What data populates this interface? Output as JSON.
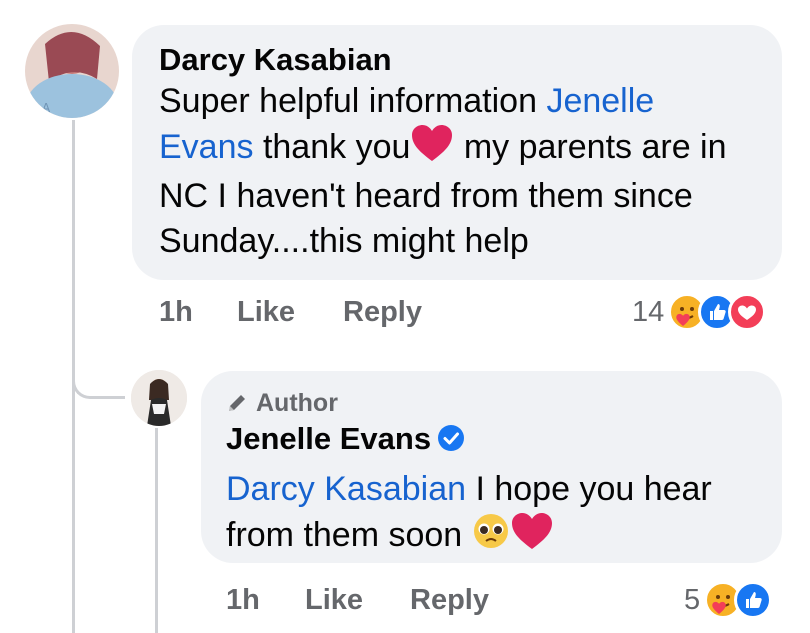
{
  "comment": {
    "author": "Darcy Kasabian",
    "text_lines": [
      {
        "pre": "Super helpful information ",
        "mention": "Jenelle",
        "post": ""
      },
      {
        "pre": "",
        "mention": "Evans",
        "post": " thank you"
      },
      {
        "pre": "",
        "mention": "",
        "post": " my parents are in"
      },
      {
        "pre": "NC I haven't heard from them since",
        "mention": "",
        "post": ""
      },
      {
        "pre": "Sunday....this might help",
        "mention": "",
        "post": ""
      }
    ],
    "time": "1h",
    "like_label": "Like",
    "reply_label": "Reply",
    "reaction_count": "14",
    "reactions": [
      "care-icon",
      "like-icon",
      "love-icon"
    ]
  },
  "reply": {
    "badge": "Author",
    "author": "Jenelle Evans",
    "verified": true,
    "mention": "Darcy Kasabian",
    "text_line1": " I hope you hear",
    "text_line2": "from them soon ",
    "time": "1h",
    "like_label": "Like",
    "reply_label": "Reply",
    "reaction_count": "5",
    "reactions": [
      "care-icon",
      "like-icon"
    ]
  },
  "colors": {
    "mention": "#1763cf",
    "bubble": "#f0f2f5",
    "meta": "#65676b",
    "like": "#1877f2",
    "love": "#f33e58",
    "heart": "#e0245e"
  }
}
